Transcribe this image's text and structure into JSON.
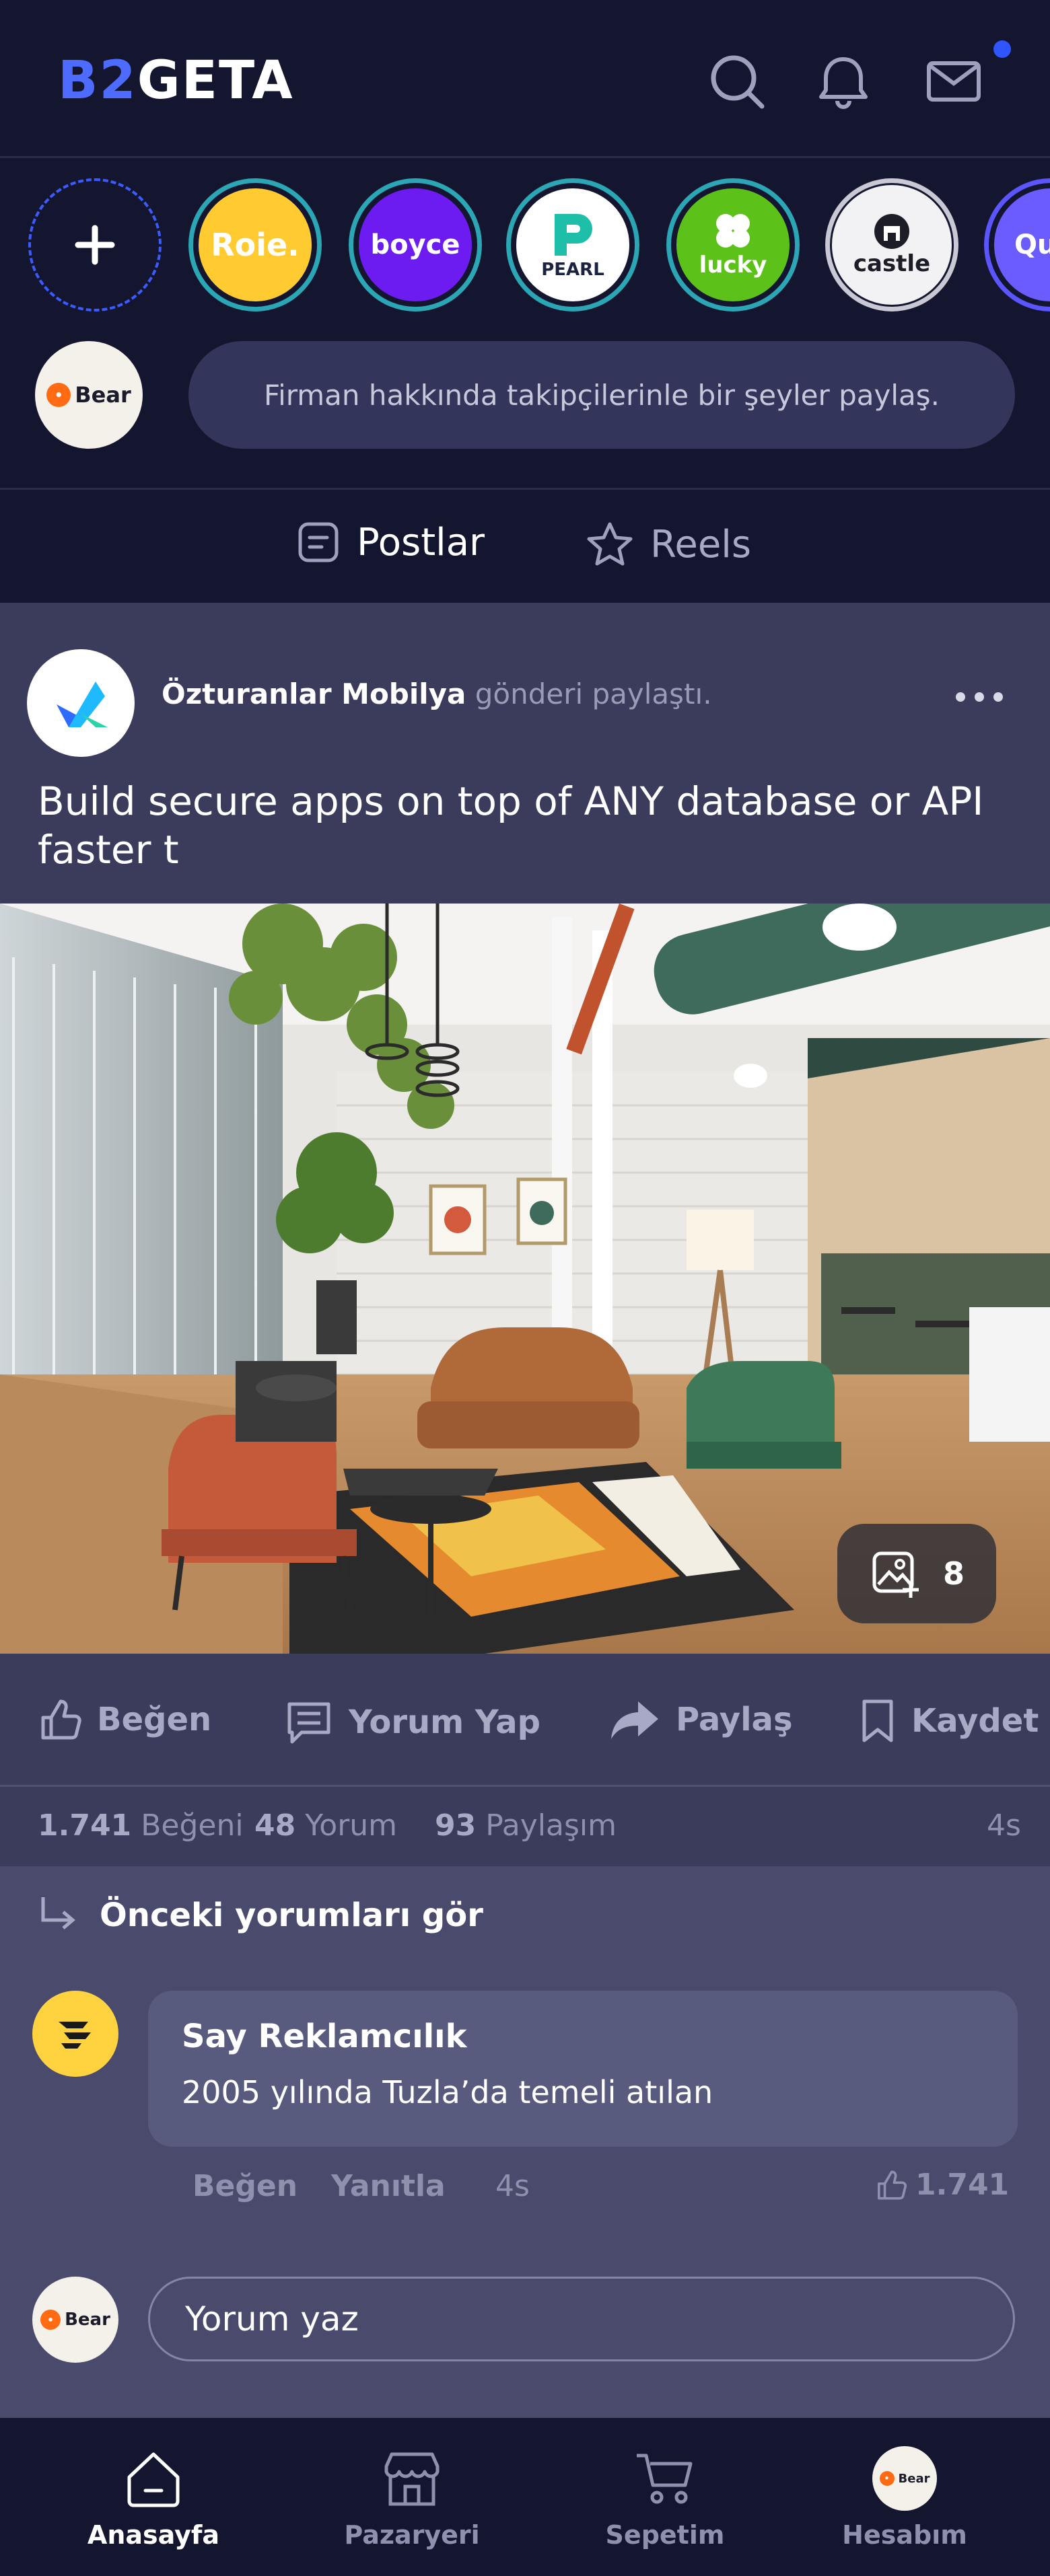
{
  "app": {
    "logo_part1": "B2",
    "logo_part2": "GETA"
  },
  "header": {
    "icons": [
      "search-icon",
      "bell-icon",
      "mail-icon"
    ],
    "notification_dot_color": "#2f55ff"
  },
  "stories": {
    "items": [
      {
        "label": "Roie."
      },
      {
        "label": "boyce"
      },
      {
        "label": "PEARL"
      },
      {
        "label": "lucky"
      },
      {
        "label": "castle"
      },
      {
        "label": "Qu"
      }
    ]
  },
  "composer": {
    "avatar_label": "Bear",
    "placeholder": "Firman hakkında takipçilerinle bir şeyler paylaş."
  },
  "tabs": [
    {
      "label": "Postlar",
      "active": true
    },
    {
      "label": "Reels",
      "active": false
    }
  ],
  "post": {
    "author": "Özturanlar Mobilya",
    "action": "gönderi paylaştı.",
    "text": "Build secure apps on top of ANY database or API faster t",
    "photo_count": "8",
    "actions": {
      "like": "Beğen",
      "comment": "Yorum Yap",
      "share": "Paylaş",
      "save": "Kaydet"
    },
    "stats": {
      "likes_count": "1.741",
      "likes_label": "Beğeni",
      "comments_count": "48",
      "comments_label": "Yorum",
      "shares_count": "93",
      "shares_label": "Paylaşım",
      "time": "4s"
    }
  },
  "comments": {
    "previous_label": "Önceki yorumları gör",
    "items": [
      {
        "author": "Say Reklamcılık",
        "text": "2005 yılında Tuzla’da temeli atılan",
        "like_label": "Beğen",
        "reply_label": "Yanıtla",
        "time": "4s",
        "likes": "1.741"
      }
    ],
    "reply_avatar_label": "Bear",
    "reply_placeholder": "Yorum yaz"
  },
  "bottom_nav": [
    {
      "label": "Anasayfa",
      "icon": "home-icon",
      "active": true
    },
    {
      "label": "Pazaryeri",
      "icon": "store-icon",
      "active": false
    },
    {
      "label": "Sepetim",
      "icon": "cart-icon",
      "active": false
    },
    {
      "label": "Hesabım",
      "icon": "avatar",
      "active": false
    }
  ]
}
